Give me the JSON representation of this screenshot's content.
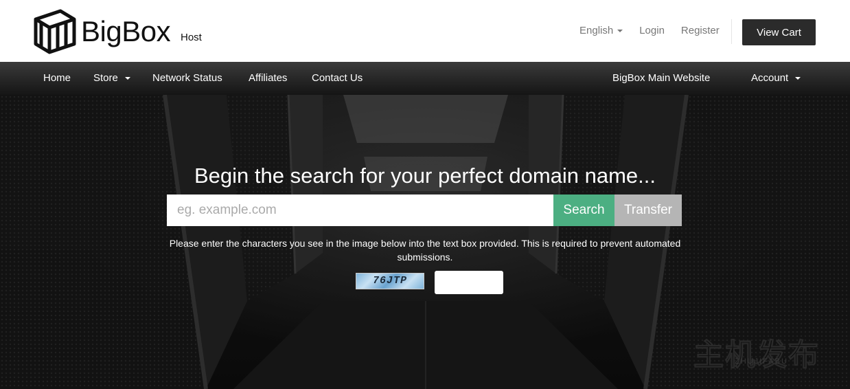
{
  "brand": {
    "name": "BigBox",
    "suffix": "Host"
  },
  "top_links": {
    "language": "English",
    "login": "Login",
    "register": "Register",
    "cart": "View Cart"
  },
  "nav": {
    "home": "Home",
    "store": "Store",
    "network_status": "Network Status",
    "affiliates": "Affiliates",
    "contact": "Contact Us",
    "main_website": "BigBox Main Website",
    "account": "Account"
  },
  "hero": {
    "headline": "Begin the search for your perfect domain name...",
    "search_placeholder": "eg. example.com",
    "search_button": "Search",
    "transfer_button": "Transfer",
    "captcha_instructions": "Please enter the characters you see in the image below into the text box provided. This is required to prevent automated submissions.",
    "captcha_code": "76JTP"
  },
  "watermark": {
    "cn": "主机发布",
    "en": "ZHUJIFABU"
  },
  "colors": {
    "search_button": "#4caf82",
    "transfer_button": "#b5b5b5",
    "nav_bg": "#1f1f1f",
    "cart_bg": "#2b2b2b"
  }
}
